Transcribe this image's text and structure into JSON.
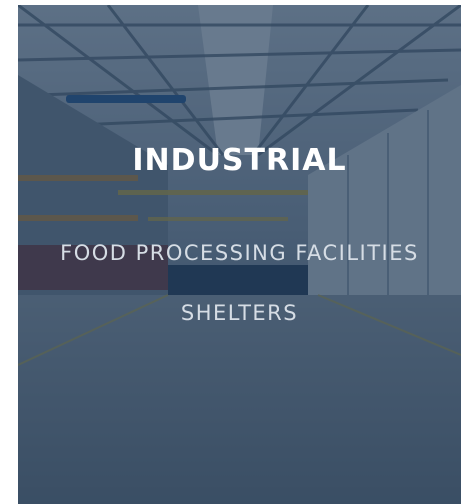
{
  "card": {
    "title": "INDUSTRIAL",
    "links": [
      {
        "label": "FOOD PROCESSING FACILITIES"
      },
      {
        "label": "SHELTERS"
      }
    ],
    "overlay_color": "#1a3452",
    "text_color": "#ffffff"
  }
}
